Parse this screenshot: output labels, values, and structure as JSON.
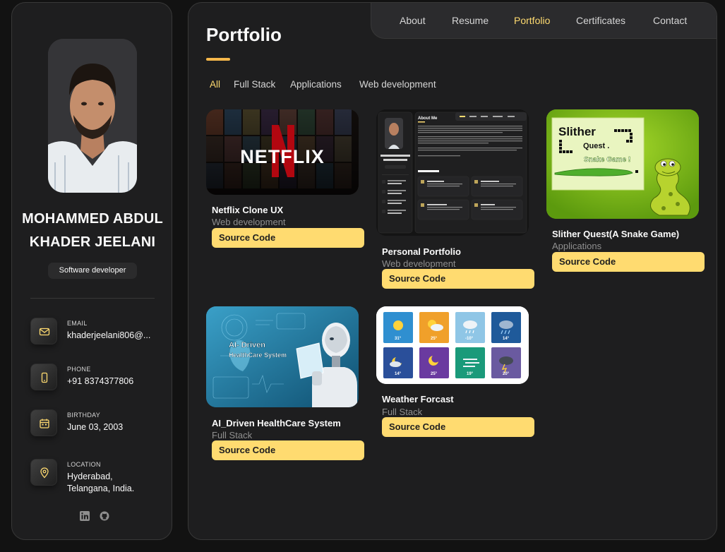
{
  "profile": {
    "name_line1": "MOHAMMED ABDUL",
    "name_line2": "KHADER JEELANI",
    "title": "Software developer",
    "contacts": [
      {
        "label": "EMAIL",
        "value": "khaderjeelani806@...",
        "icon": "mail-icon"
      },
      {
        "label": "PHONE",
        "value": "+91 8374377806",
        "icon": "phone-icon"
      },
      {
        "label": "BIRTHDAY",
        "value": "June 03, 2003",
        "icon": "calendar-icon"
      },
      {
        "label": "LOCATION",
        "value": "Hyderabad,\nTelangana, India.",
        "icon": "location-pin-icon"
      }
    ],
    "socials": [
      "linkedin-icon",
      "github-icon"
    ]
  },
  "nav": {
    "items": [
      "About",
      "Resume",
      "Portfolio",
      "Certificates",
      "Contact"
    ],
    "active": "Portfolio"
  },
  "page": {
    "title": "Portfolio"
  },
  "filters": {
    "items": [
      "All",
      "Full Stack",
      "Applications",
      "Web development"
    ],
    "active": "All"
  },
  "projects": [
    {
      "title": "Netflix Clone UX",
      "category": "Web development",
      "button": "Source Code",
      "image_text": "NETFLIX"
    },
    {
      "title": "Personal Portfolio",
      "category": "Web development",
      "button": "Source Code",
      "image_text": "About Me"
    },
    {
      "title": "Slither Quest(A Snake Game)",
      "category": "Applications",
      "button": "Source Code",
      "image_text": [
        "Slither",
        "Quest .",
        "Snake Game !"
      ]
    },
    {
      "title": "AI_Driven HealthCare System",
      "category": "Full Stack",
      "button": "Source Code",
      "image_text": [
        "AI- Driven",
        "HealthCare System"
      ]
    },
    {
      "title": "Weather Forcast",
      "category": "Full Stack",
      "button": "Source Code",
      "image_text": [
        "31°",
        "25°",
        "-10°",
        "14°",
        "14°",
        "25°",
        "19°",
        "20°"
      ]
    }
  ],
  "colors": {
    "accent": "#ffdb70",
    "background": "#121212",
    "panel": "#1e1e1f",
    "border": "#383838",
    "muted_text": "#8f8f8f"
  }
}
